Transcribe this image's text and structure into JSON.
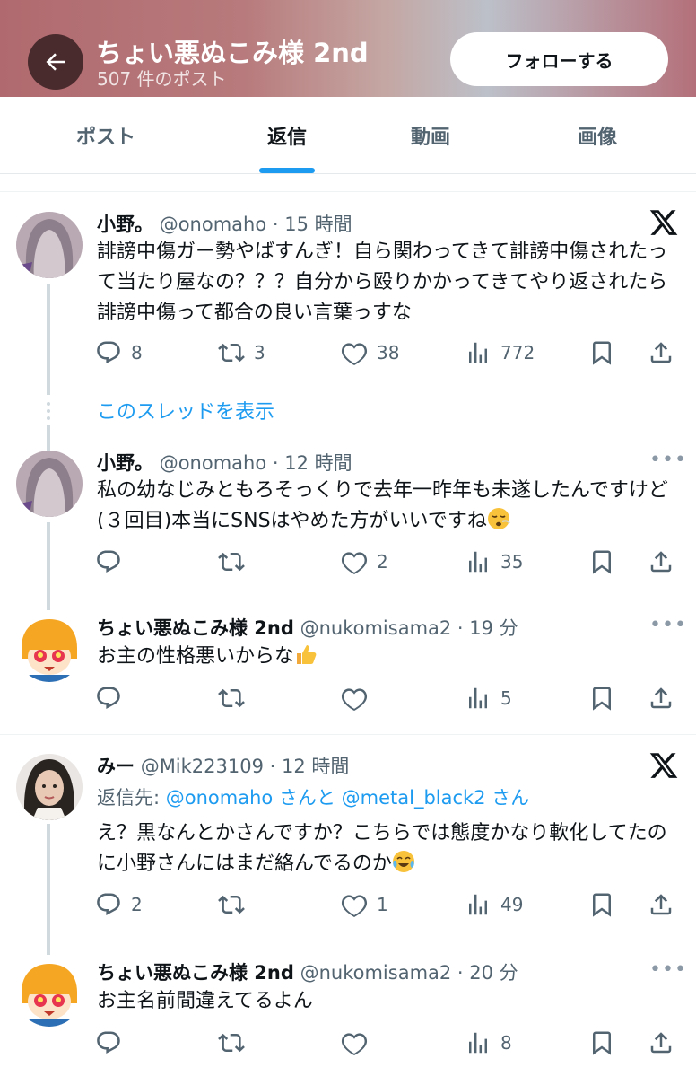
{
  "header": {
    "back_icon": "arrow-left-icon",
    "title": "ちょい悪ぬこみ様 2nd",
    "post_count": "507 件のポスト",
    "follow_label": "フォローする"
  },
  "tabs": [
    {
      "label": "ポスト"
    },
    {
      "label": "返信",
      "active": true
    },
    {
      "label": "動画"
    },
    {
      "label": "画像"
    }
  ],
  "colors": {
    "accent": "#1d9bf0",
    "header_bg": "#b87a7c"
  },
  "tweets": [
    {
      "name": "小野。",
      "handle": "@onomaho · 15 時間",
      "text": "誹謗中傷ガー勢やばすんぎ！自ら関わってきて誹謗中傷されたって当たり屋なの？？？自分から殴りかかってきてやり返されたら誹謗中傷って都合の良い言葉っすな",
      "replies": "8",
      "reposts": "3",
      "likes": "38",
      "views": "772"
    },
    {
      "show_thread": "このスレッドを表示"
    },
    {
      "name": "小野。",
      "handle": "@onomaho · 12 時間",
      "text": "私の幼なじみともろそっくりで去年一昨年も未遂したんですけど(３回目)本当にSNSはやめた方がいいですね",
      "replies": "",
      "reposts": "",
      "likes": "2",
      "views": "35"
    },
    {
      "name": "ちょい悪ぬこみ様 2nd",
      "handle": "@nukomisama2 · 19 分",
      "text": "お主の性格悪いからな",
      "replies": "",
      "reposts": "",
      "likes": "",
      "views": "5"
    },
    {
      "name": "みー",
      "handle": "@Mik223109 · 12 時間",
      "reply_prefix": "返信先: ",
      "reply_user1": "@onomaho",
      "reply_mid": " さんと ",
      "reply_user2": "@metal_black2",
      "reply_suffix": " さん",
      "text": "え？黒なんとかさんですか？こちらでは態度かなり軟化してたのに小野さんにはまだ絡んでるのか",
      "replies": "2",
      "reposts": "",
      "likes": "1",
      "views": "49"
    },
    {
      "name": "ちょい悪ぬこみ様 2nd",
      "handle": "@nukomisama2 · 20 分",
      "text": "お主名前間違えてるよん",
      "replies": "",
      "reposts": "",
      "likes": "",
      "views": "8"
    }
  ]
}
